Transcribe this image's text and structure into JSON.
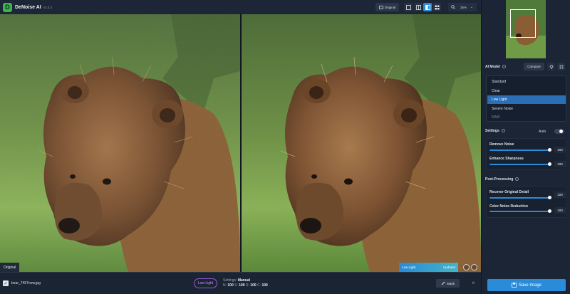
{
  "app": {
    "name": "DeNoise AI",
    "version": "v3.3.4",
    "logo_letter": "D"
  },
  "toolbar": {
    "original_label": "Original",
    "zoom_label": "35%",
    "zoom_caret": "⌄"
  },
  "viewer": {
    "left_tag": "Original",
    "right_model": "Low Light",
    "right_status": "Updated"
  },
  "bottom": {
    "file_name": "bear_7457new.jpg",
    "model_pill": "Low Light",
    "settings_prefix": "Settings:",
    "settings_mode": "Manual",
    "n_label": "N:",
    "n_value": "100",
    "s_label": "S:",
    "s_value": "100",
    "r_label": "R:",
    "r_value": "100",
    "c_label": "C:",
    "c_value": "100",
    "mask_label": "Mask",
    "close": "×"
  },
  "panel": {
    "ai_model_title": "AI Model",
    "compare_label": "Compare",
    "models": [
      {
        "label": "Standard"
      },
      {
        "label": "Clear"
      },
      {
        "label": "Low Light"
      },
      {
        "label": "Severe Noise"
      },
      {
        "label": "RAW"
      }
    ],
    "active_model_index": 2,
    "settings_title": "Settings",
    "auto_label": "Auto",
    "sliders_a": [
      {
        "label": "Remove Noise",
        "value": "100"
      },
      {
        "label": "Enhance Sharpness",
        "value": "100"
      }
    ],
    "post_title": "Post-Processing",
    "sliders_b": [
      {
        "label": "Recover Original Detail",
        "value": "100"
      },
      {
        "label": "Color Noise Reduction",
        "value": "100"
      }
    ],
    "save_label": "Save Image"
  },
  "colors": {
    "accent": "#2a8bd8",
    "pill": "#9a55d8",
    "logo": "#3bb54a"
  }
}
